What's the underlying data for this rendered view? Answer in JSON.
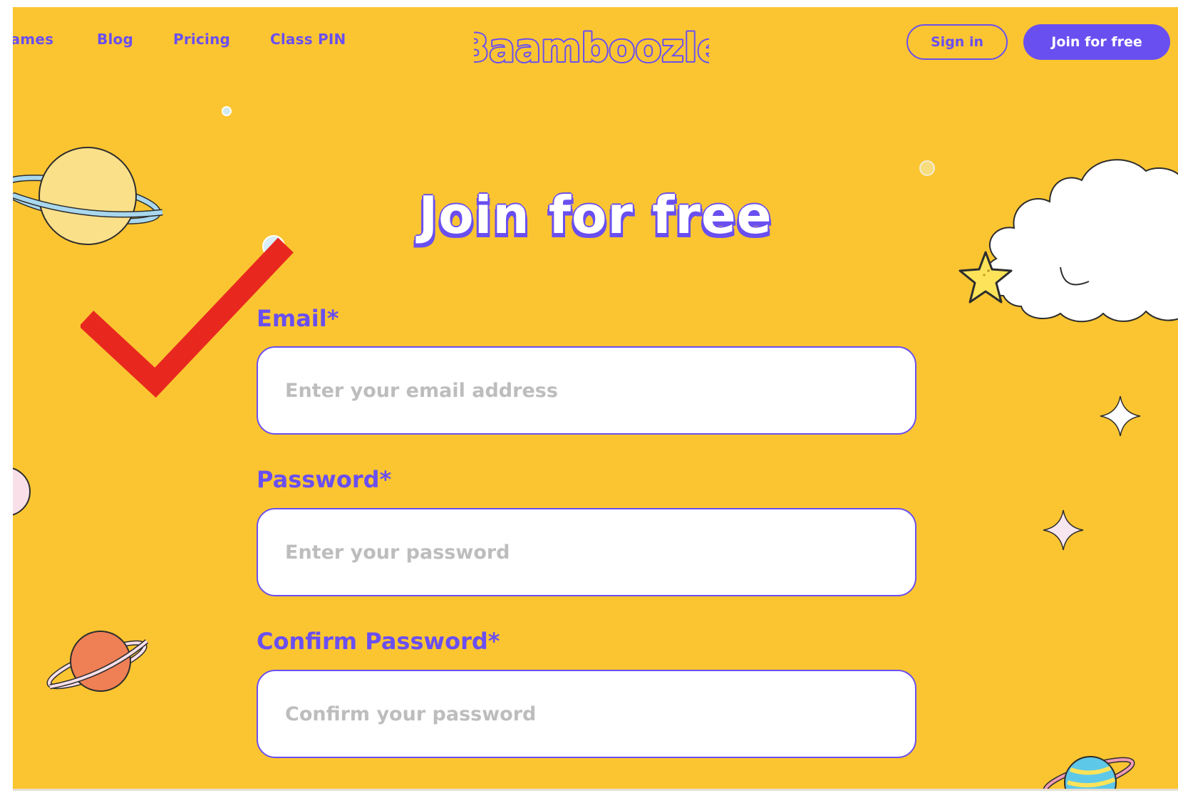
{
  "nav": {
    "items": [
      {
        "label": "Games"
      },
      {
        "label": "Blog"
      },
      {
        "label": "Pricing"
      },
      {
        "label": "Class PIN"
      }
    ]
  },
  "logo": {
    "text": "Baamboozle"
  },
  "header_actions": {
    "sign_in_label": "Sign in",
    "join_label": "Join for free"
  },
  "page": {
    "title": "Join for free"
  },
  "form": {
    "email": {
      "label": "Email*",
      "placeholder": "Enter your email address",
      "value": ""
    },
    "password": {
      "label": "Password*",
      "placeholder": "Enter your password",
      "value": ""
    },
    "confirm_password": {
      "label": "Confirm Password*",
      "placeholder": "Confirm your password",
      "value": ""
    }
  },
  "colors": {
    "background": "#fbc531",
    "accent": "#6a4ff0",
    "annotation_check": "#e8281e"
  },
  "icons": [
    "checkmark-annotation-icon",
    "planet-icon",
    "cloud-icon",
    "star-icon",
    "sparkle-icon"
  ]
}
